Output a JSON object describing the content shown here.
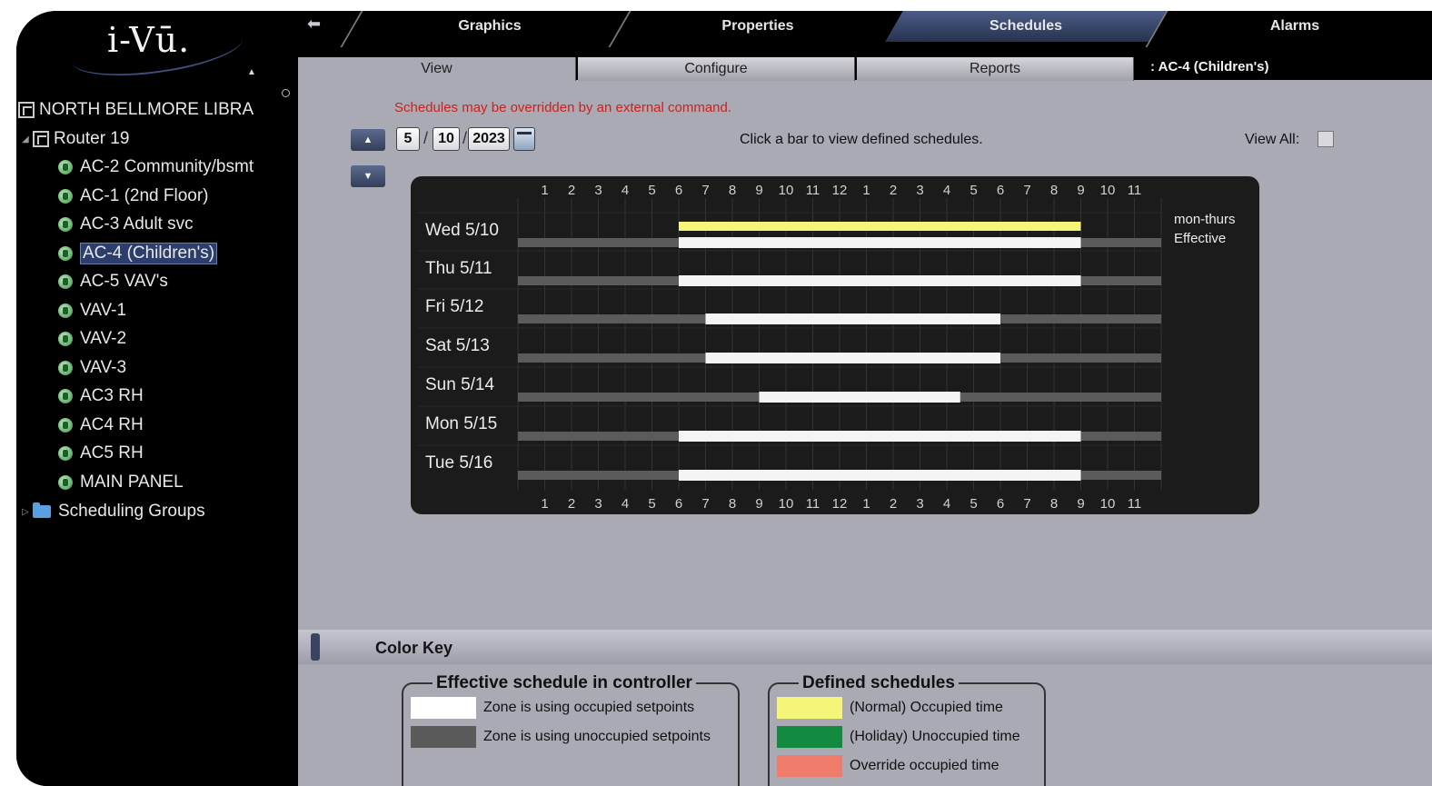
{
  "logo": {
    "text": "i-Vū."
  },
  "top_tabs": [
    "Graphics",
    "Properties",
    "Schedules",
    "Alarms"
  ],
  "active_top_tab": "Schedules",
  "sub_tabs": [
    "View",
    "Configure",
    "Reports"
  ],
  "breadcrumb": ": AC-4 (Children's)",
  "tree": {
    "root": "NORTH BELLMORE LIBRA",
    "router": "Router 19",
    "items": [
      "AC-2 Community/bsmt",
      "AC-1 (2nd Floor)",
      "AC-3 Adult svc",
      "AC-4 (Children's)",
      "AC-5 VAV's",
      "VAV-1",
      "VAV-2",
      "VAV-3",
      "AC3 RH",
      "AC4 RH",
      "AC5 RH",
      "MAIN PANEL"
    ],
    "selected": "AC-4 (Children's)",
    "group": "Scheduling Groups"
  },
  "warning": "Schedules may be overridden by an external command.",
  "date": {
    "month": "5",
    "day": "10",
    "year": "2023"
  },
  "hint": "Click a bar to view defined schedules.",
  "view_all_label": "View All:",
  "schedule": {
    "hour_labels": [
      "1",
      "2",
      "3",
      "4",
      "5",
      "6",
      "7",
      "8",
      "9",
      "10",
      "11",
      "12",
      "1",
      "2",
      "3",
      "4",
      "5",
      "6",
      "7",
      "8",
      "9",
      "10",
      "11"
    ],
    "days": [
      {
        "label": "Wed 5/10",
        "start": 6,
        "end": 21,
        "normal": [
          6,
          21
        ]
      },
      {
        "label": "Thu 5/11",
        "start": 6,
        "end": 21
      },
      {
        "label": "Fri 5/12",
        "start": 7,
        "end": 18
      },
      {
        "label": "Sat 5/13",
        "start": 7,
        "end": 18
      },
      {
        "label": "Sun 5/14",
        "start": 9,
        "end": 16.5
      },
      {
        "label": "Mon 5/15",
        "start": 6,
        "end": 21
      },
      {
        "label": "Tue 5/16",
        "start": 6,
        "end": 21
      }
    ],
    "side_labels": [
      "mon-thurs",
      "Effective"
    ]
  },
  "color_key": {
    "title": "Color Key",
    "effective": {
      "legend": "Effective schedule in controller",
      "rows": [
        {
          "label": "Zone is using occupied setpoints",
          "color": "#ffffff"
        },
        {
          "label": "Zone is using unoccupied setpoints",
          "color": "#5a5a5a"
        }
      ]
    },
    "defined": {
      "legend": "Defined schedules",
      "rows": [
        {
          "label": "(Normal) Occupied time",
          "color": "#f5f57a"
        },
        {
          "label": "(Holiday) Unoccupied time",
          "color": "#138a3f"
        },
        {
          "label": "Override occupied time",
          "color": "#f07c6c"
        }
      ]
    }
  },
  "colors": {
    "accent": "#2c3f6c",
    "warning": "#d0201c",
    "panel": "#a9aab4"
  }
}
